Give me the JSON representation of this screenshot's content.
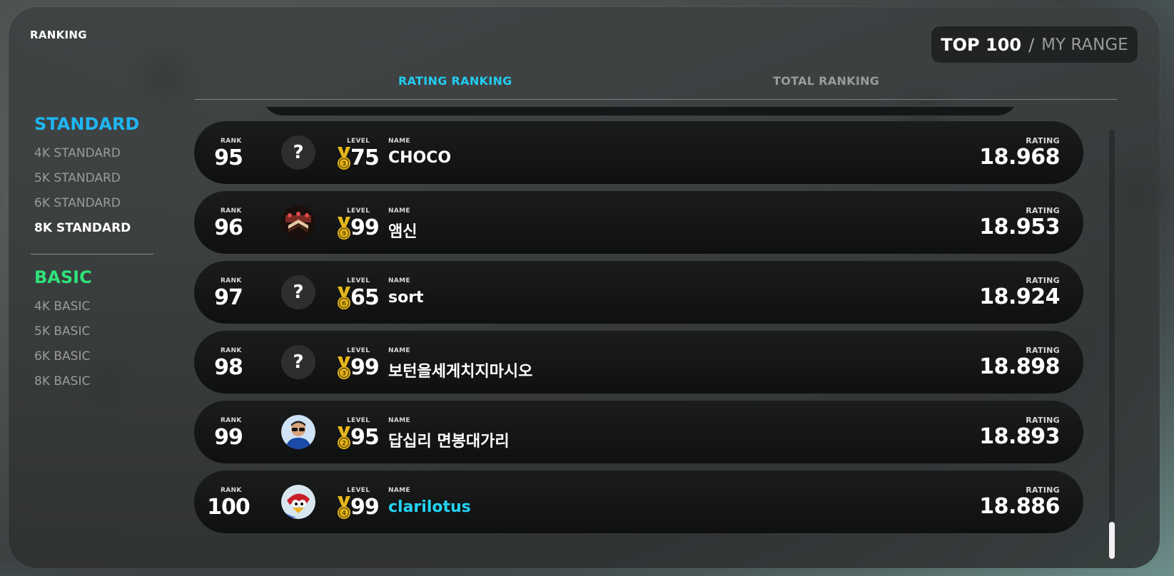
{
  "header": {
    "title": "RANKING"
  },
  "range_toggle": {
    "active": "TOP 100",
    "separator": "/",
    "inactive": "MY RANGE"
  },
  "tabs": {
    "active": "RATING RANKING",
    "inactive": "TOTAL RANKING"
  },
  "sidebar": {
    "standard": {
      "title": "STANDARD",
      "items": [
        "4K STANDARD",
        "5K STANDARD",
        "6K STANDARD",
        "8K STANDARD"
      ],
      "selected": "8K STANDARD"
    },
    "basic": {
      "title": "BASIC",
      "items": [
        "4K BASIC",
        "5K BASIC",
        "6K BASIC",
        "8K BASIC"
      ]
    }
  },
  "labels": {
    "rank": "RANK",
    "level": "LEVEL",
    "name": "NAME",
    "rating": "RATING"
  },
  "rows": [
    {
      "rank": "95",
      "avatar": "unknown",
      "avatar_text": "?",
      "medal": "3",
      "level": "75",
      "name": "CHOCO",
      "rating": "18.968",
      "is_me": false
    },
    {
      "rank": "96",
      "avatar": "cake",
      "medal": "9",
      "level": "99",
      "name": "앰신",
      "rating": "18.953",
      "is_me": false
    },
    {
      "rank": "97",
      "avatar": "unknown",
      "avatar_text": "?",
      "medal": "6",
      "level": "65",
      "name": "sort",
      "rating": "18.924",
      "is_me": false
    },
    {
      "rank": "98",
      "avatar": "unknown",
      "avatar_text": "?",
      "medal": "3",
      "level": "99",
      "name": "보턴을세게치지마시오",
      "rating": "18.898",
      "is_me": false
    },
    {
      "rank": "99",
      "avatar": "person",
      "medal": "2",
      "level": "95",
      "name": "답십리 면봉대가리",
      "rating": "18.893",
      "is_me": false
    },
    {
      "rank": "100",
      "avatar": "bird",
      "medal": "4",
      "level": "99",
      "name": "clarilotus",
      "rating": "18.886",
      "is_me": true
    }
  ],
  "colors": {
    "accent_cyan": "#22ccf0",
    "standard_blue": "#1fb6f2",
    "basic_green": "#2ee27a",
    "medal_gold": "#e8b81c"
  },
  "scroll": {
    "position": 1.0
  }
}
